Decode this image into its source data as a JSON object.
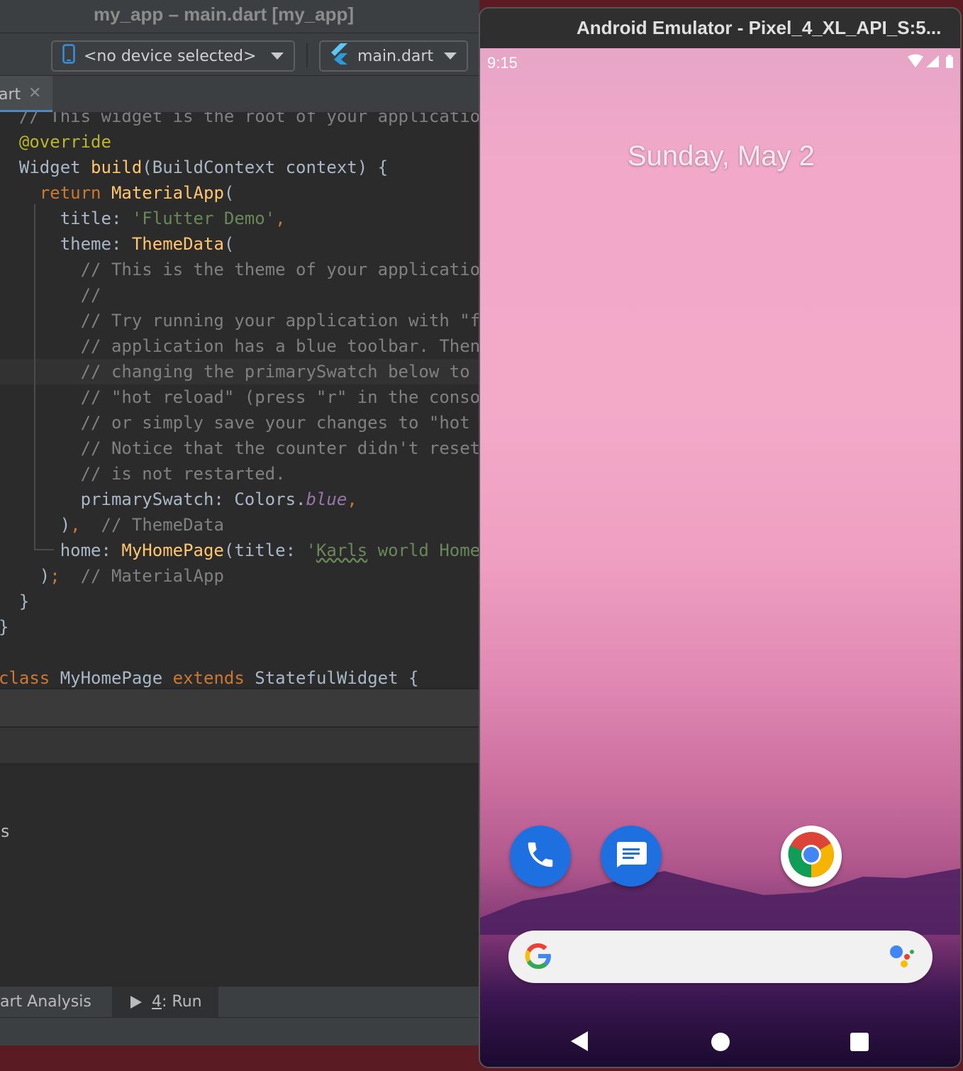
{
  "ide": {
    "window_title": "my_app – main.dart [my_app]",
    "device_selector": {
      "label": "<no device selected>",
      "icon": "phone-device-icon"
    },
    "run_config": {
      "label": "main.dart",
      "icon": "flutter-icon"
    },
    "tab": {
      "label": "art",
      "close": "✕"
    },
    "code": [
      "  // This widget is the root of your application",
      "  @override",
      "  Widget build(BuildContext context) {",
      "    return MaterialApp(",
      "      title: 'Flutter Demo',",
      "      theme: ThemeData(",
      "        // This is the theme of your application",
      "        //",
      "        // Try running your application with \"fl",
      "        // application has a blue toolbar. Then,",
      "        // changing the primarySwatch below to C",
      "        // \"hot reload\" (press \"r\" in the consol",
      "        // or simply save your changes to \"hot r",
      "        // Notice that the counter didn't reset",
      "        // is not restarted.",
      "        primarySwatch: Colors.blue,",
      "      ),  // ThemeData",
      "      home: MyHomePage(title: 'Karls world Home",
      "    );  // MaterialApp",
      "  }",
      "}",
      "",
      "class MyHomePage extends StatefulWidget {"
    ],
    "panel_fragment": "s",
    "bottom_tabs": {
      "dart_analysis": "art Analysis",
      "run_number": "4",
      "run_label": ": Run"
    }
  },
  "emulator": {
    "window_title": "Android Emulator - Pixel_4_XL_API_S:5...",
    "status_time": "9:15",
    "date": "Sunday, May 2",
    "apps": [
      {
        "name": "Phone",
        "icon": "phone-icon"
      },
      {
        "name": "Messages",
        "icon": "messages-icon"
      },
      {
        "name": "Chrome",
        "icon": "chrome-icon"
      }
    ],
    "search_icons": [
      "google-g-icon",
      "assistant-icon"
    ],
    "nav": [
      "back",
      "home",
      "recents"
    ]
  },
  "colors": {
    "ide_bg": "#2b2b2b",
    "keyword": "#cc7832",
    "function": "#ffc66d",
    "string": "#6a8759",
    "comment": "#808080",
    "annotation": "#bbb529",
    "field": "#9876aa",
    "android_blue": "#1e6fe0"
  }
}
